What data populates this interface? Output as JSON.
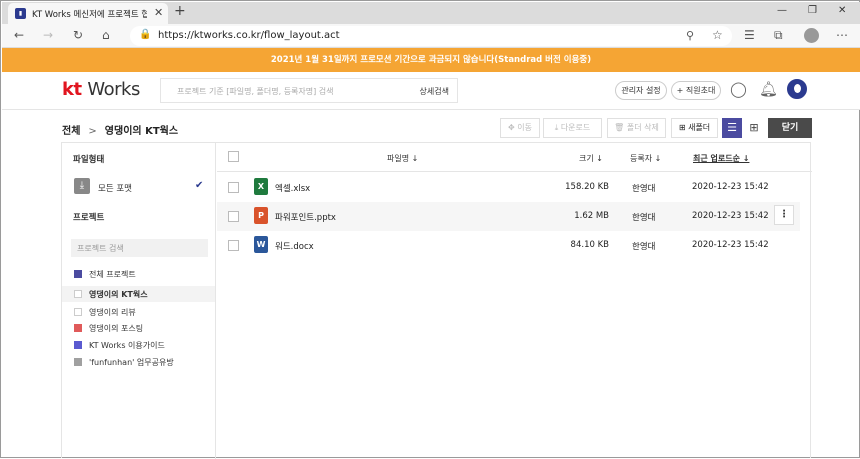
{
  "browser": {
    "tab_title": "KT Works 메신저에 프로젝트 협업",
    "tab_close": "✕",
    "new_tab": "+",
    "url": "https://ktworks.co.kr/flow_layout.act"
  },
  "banner": {
    "text": "2021년 1월 31일까지 프로모션 기간으로 과금되지 않습니다(Standrad 버전 이용중)"
  },
  "header": {
    "logo_kt": "kt",
    "logo_works": "Works",
    "search_placeholder": "프로젝트 기준 [파일명, 폴더명, 등록자명] 검색",
    "advanced_search": "상세검색",
    "admin_settings": "관리자 설정",
    "invite": "+ 직원초대"
  },
  "toolbar": {
    "crumb_root": "전체",
    "crumb_sep": ">",
    "crumb_current": "영댕이의 KT웍스",
    "move": "이동",
    "download": "다운로드",
    "delete_folder": "폴더 삭제",
    "new_folder": "새폴더",
    "close": "닫기"
  },
  "left_panel": {
    "file_type_heading": "파일형태",
    "all_formats": "모든 포맷",
    "project_heading": "프로젝트",
    "project_search_placeholder": "프로젝트 검색",
    "projects": [
      {
        "name": "전체 프로젝트",
        "color": "#4b4ba0",
        "selected": false
      },
      {
        "name": "영댕이의 KT웍스",
        "color": "#ffffff",
        "selected": true
      },
      {
        "name": "영댕이의 리뷰",
        "color": "#ffffff",
        "selected": false
      },
      {
        "name": "영댕이의 포스팅",
        "color": "#e05a5a",
        "selected": false
      },
      {
        "name": "KT Works 이용가이드",
        "color": "#5a5ad0",
        "selected": false
      },
      {
        "name": "'funfunhan' 업무공유방",
        "color": "#a0a0a0",
        "selected": false
      }
    ]
  },
  "file_list": {
    "columns": {
      "name": "파일명 ↓",
      "size": "크기 ↓",
      "owner": "등록자 ↓",
      "date": "최근 업로드순 ↓"
    },
    "files": [
      {
        "icon_letter": "X",
        "icon_color": "#1f7a3e",
        "name": "엑셀.xlsx",
        "size": "158.20 KB",
        "owner": "한영대",
        "date": "2020-12-23 15:42"
      },
      {
        "icon_letter": "P",
        "icon_color": "#d9532b",
        "name": "파워포인트.pptx",
        "size": "1.62 MB",
        "owner": "한영대",
        "date": "2020-12-23 15:42"
      },
      {
        "icon_letter": "W",
        "icon_color": "#2b579a",
        "name": "워드.docx",
        "size": "84.10 KB",
        "owner": "한영대",
        "date": "2020-12-23 15:42"
      }
    ],
    "more_button": "⋮"
  },
  "colors": {
    "banner": "#f5a534",
    "brand": "#e1151f",
    "accent": "#2b3a8f"
  }
}
